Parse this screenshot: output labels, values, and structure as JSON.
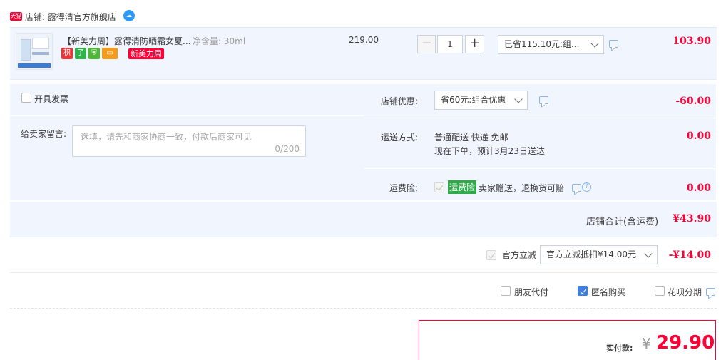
{
  "shop": {
    "badge": "天猫",
    "label": "店铺: 露得清官方旗舰店",
    "ww_icon": "wangwang-icon"
  },
  "item": {
    "title": "【新美力周】露得清防晒霜女夏...",
    "spec": "净含量: 30ml",
    "tags": [
      "积",
      "了",
      "",
      ""
    ],
    "promo_tag": "新美力周",
    "unit_price": "219.00",
    "qty_minus": "−",
    "quantity": "1",
    "qty_plus": "+",
    "discount_select": "已省115.10元:组...",
    "total": "103.90"
  },
  "invoice": {
    "label": "开具发票"
  },
  "note": {
    "label": "给卖家留言:",
    "placeholder": "选填，请先和商家协商一致，付款后商家可见",
    "counter": "0/200"
  },
  "shop_discount": {
    "label": "店铺优惠:",
    "select": "省60元:组合优惠",
    "amount": "-60.00"
  },
  "shipping": {
    "label": "运送方式:",
    "method": "普通配送 快递 免邮",
    "eta": "现在下单，预计3月23日送达",
    "amount": "0.00"
  },
  "insurance": {
    "label": "运费险:",
    "badge": "运费险",
    "desc": "卖家赠送，退换货可赔",
    "amount": "0.00"
  },
  "subtotal": {
    "label": "店铺合计(含运费)",
    "amount": "¥43.90"
  },
  "official": {
    "label": "官方立减",
    "select": "官方立减抵扣¥14.00元",
    "amount": "-¥14.00"
  },
  "options": {
    "friend_pay": "朋友代付",
    "anonymous": "匿名购买",
    "huabei": "花呗分期"
  },
  "payment": {
    "label": "实付款:",
    "currency": "¥",
    "amount": "29.90"
  },
  "colors": {
    "accent_red": "#ff0036",
    "panel_bg": "#f1f5fe",
    "check_blue": "#3d7ee0"
  }
}
